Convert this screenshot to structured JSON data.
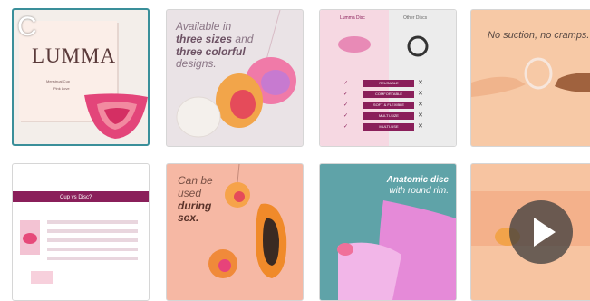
{
  "gallery": {
    "overlay_letter": "C",
    "thumbs": [
      {
        "brand": "LUMMA",
        "sub1": "Menstrual Cup",
        "sub2": "Pink Love"
      },
      {
        "text_parts": [
          "Available in",
          "three sizes",
          "and",
          "three colorful",
          "designs."
        ]
      },
      {
        "col_a": "Lumma Disc",
        "col_b": "Other Discs",
        "features": [
          "REUSABLE",
          "COMFORTABLE",
          "SOFT & FLEXIBLE",
          "MULTI-SIZE",
          "MULTI-USE"
        ]
      },
      {
        "text": "No suction, no cramps."
      },
      {
        "title": "Cup vs Disc?"
      },
      {
        "text_parts": [
          "Can be",
          "used",
          "during",
          "sex."
        ]
      },
      {
        "text_parts": [
          "Anatomic disc",
          "with round rim."
        ]
      },
      {
        "type": "video"
      }
    ]
  },
  "colors": {
    "accent": "#3a8f9a",
    "brand_purple": "#8a1f5a",
    "peach": "#f7c9a6"
  }
}
